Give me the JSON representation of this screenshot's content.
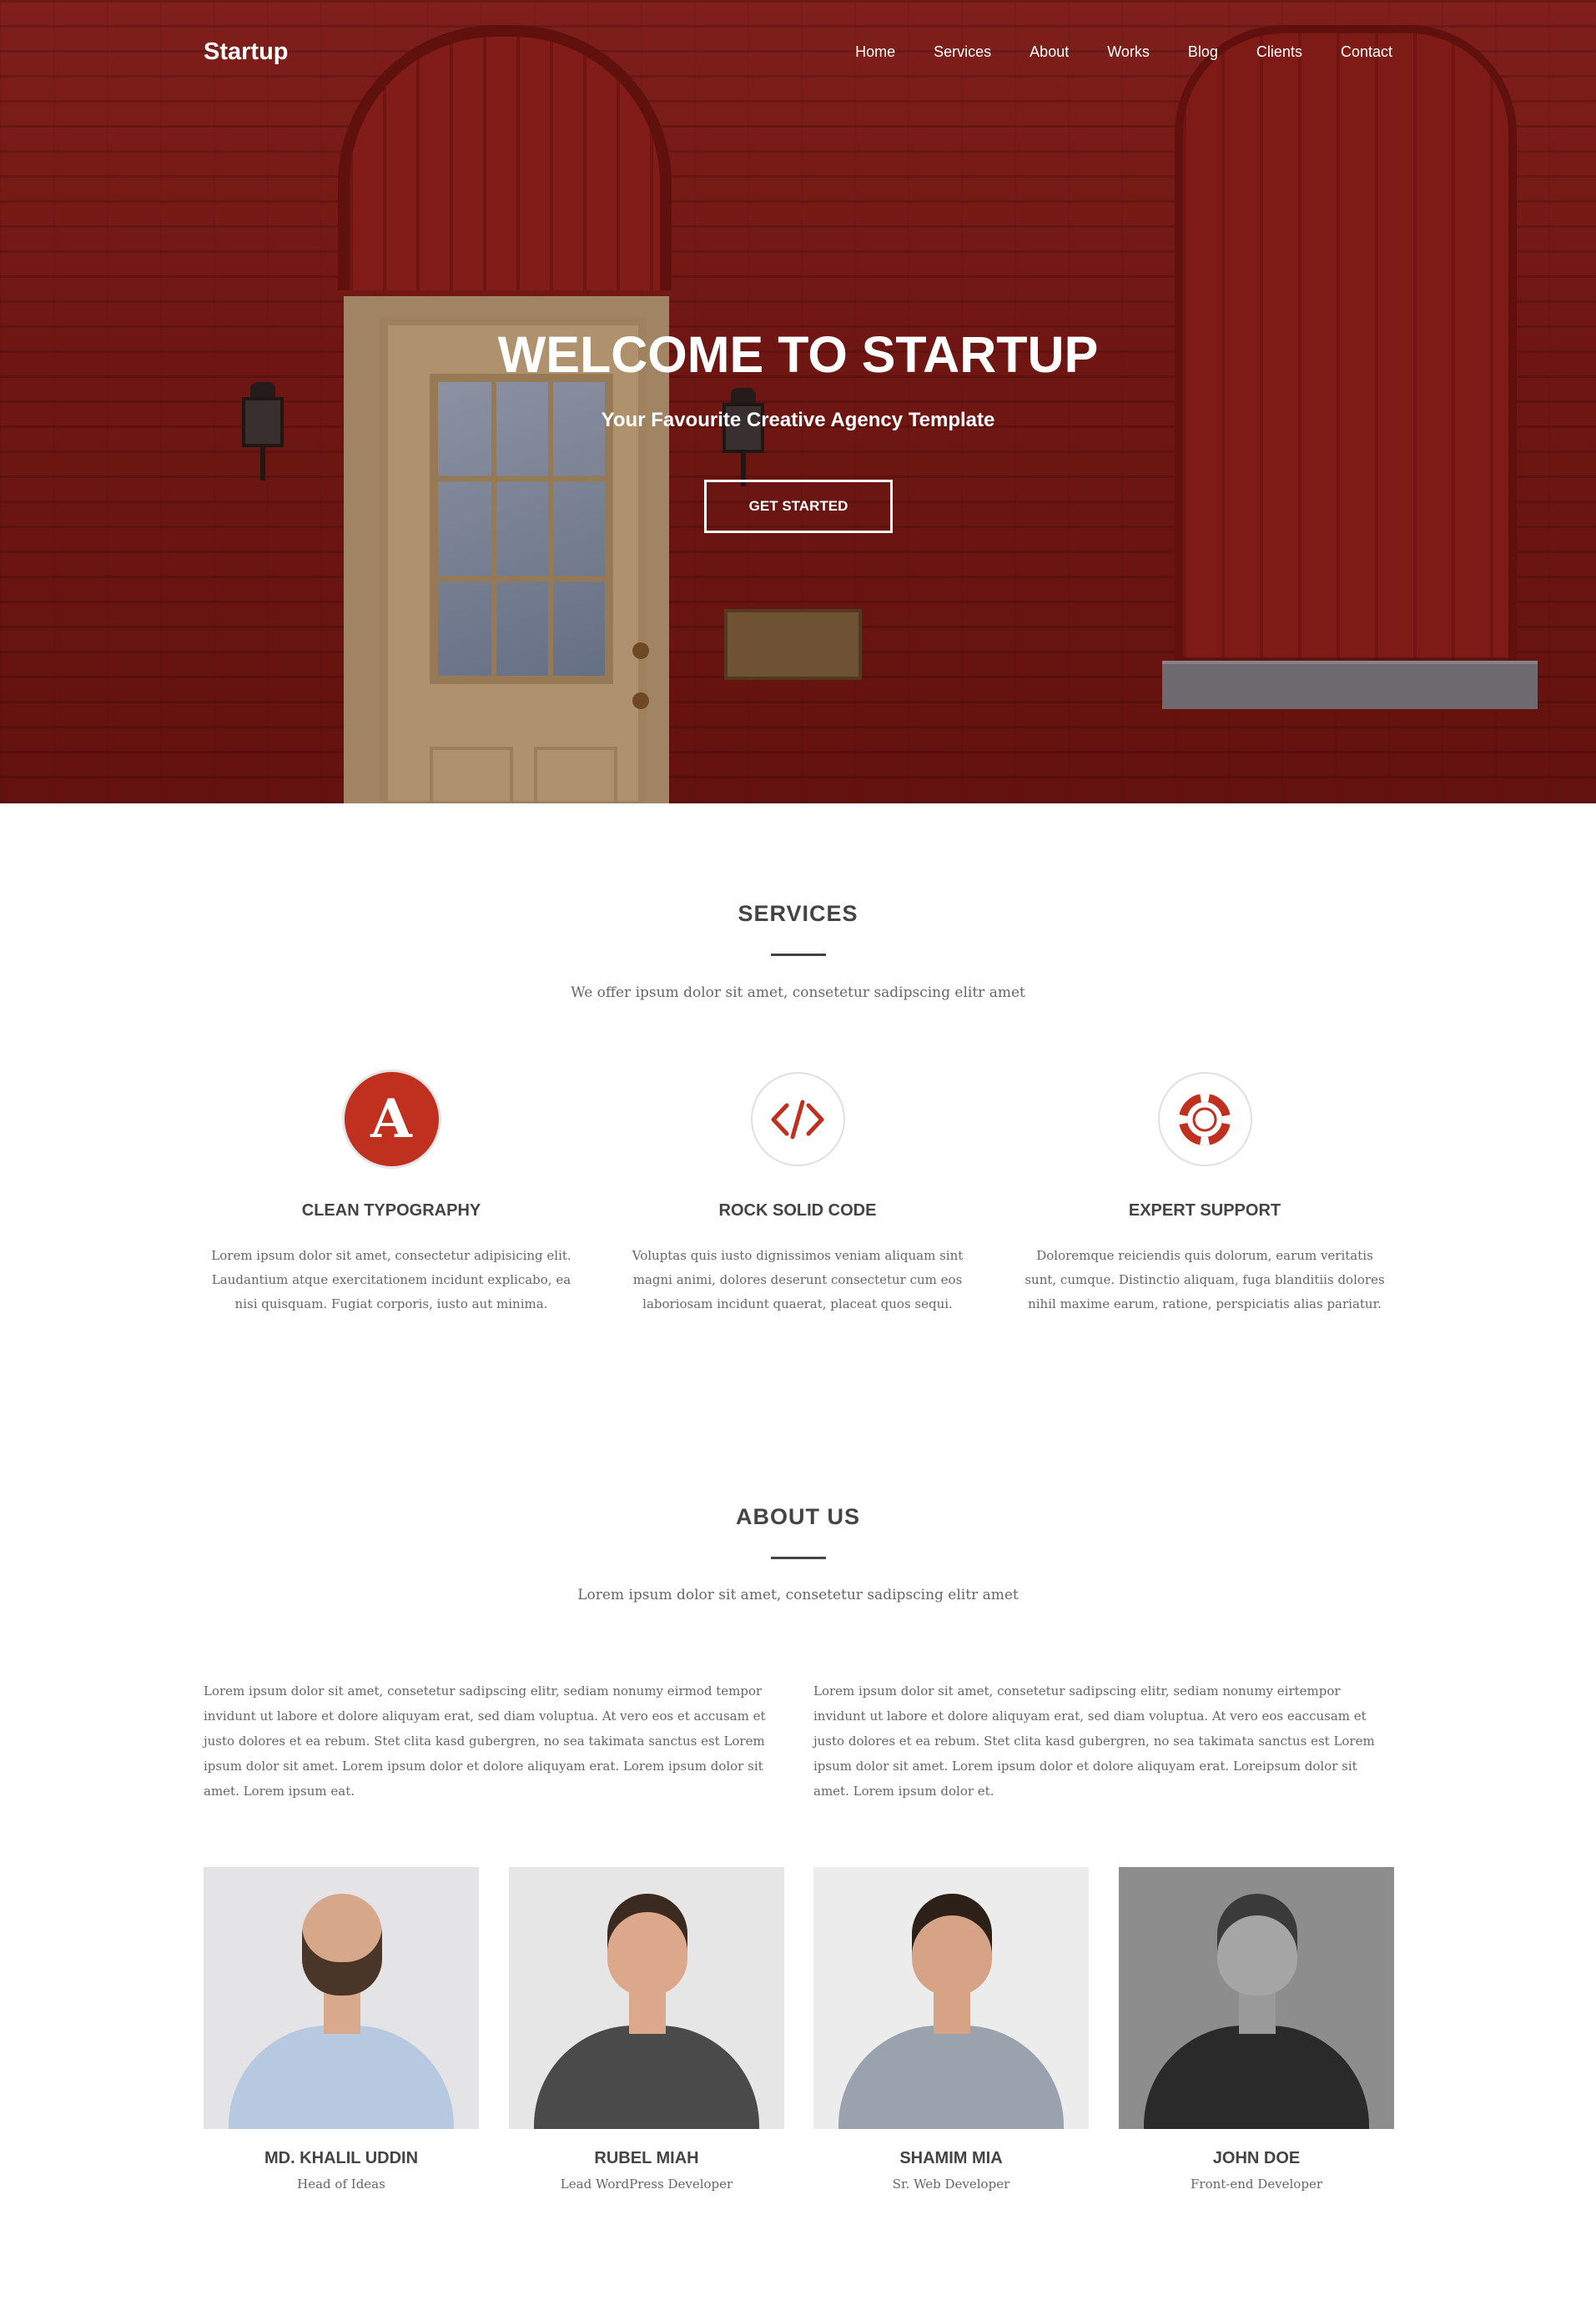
{
  "nav": {
    "brand": "Startup",
    "items": [
      "Home",
      "Services",
      "About",
      "Works",
      "Blog",
      "Clients",
      "Contact"
    ]
  },
  "hero": {
    "title": "WELCOME TO STARTUP",
    "subtitle": "Your Favourite Creative Agency Template",
    "button": "GET STARTED"
  },
  "services": {
    "title": "SERVICES",
    "subtitle": "We offer ipsum dolor sit amet, consetetur sadipscing elitr amet",
    "items": [
      {
        "name": "CLEAN TYPOGRAPHY",
        "icon": "typography-icon",
        "text": "Lorem ipsum dolor sit amet, consectetur adipisicing elit. Laudantium atque exercitationem incidunt explicabo, ea nisi quisquam. Fugiat corporis, iusto aut minima."
      },
      {
        "name": "ROCK SOLID CODE",
        "icon": "code-icon",
        "text": "Voluptas quis iusto dignissimos veniam aliquam sint magni animi, dolores deserunt consectetur cum eos laboriosam incidunt quaerat, placeat quos sequi."
      },
      {
        "name": "EXPERT SUPPORT",
        "icon": "lifebuoy-icon",
        "text": "Doloremque reiciendis quis dolorum, earum veritatis sunt, cumque. Distinctio aliquam, fuga blanditiis dolores nihil maxime earum, ratione, perspiciatis alias pariatur."
      }
    ]
  },
  "about": {
    "title": "ABOUT US",
    "subtitle": "Lorem ipsum dolor sit amet, consetetur sadipscing elitr amet",
    "col1": "Lorem ipsum dolor sit amet, consetetur sadipscing elitr, sediam nonumy eirmod tempor invidunt ut labore et dolore aliquyam erat, sed diam voluptua. At vero eos et accusam et justo dolores et ea rebum. Stet clita kasd gubergren, no sea takimata sanctus est Lorem ipsum dolor sit amet. Lorem ipsum dolor et dolore aliquyam erat. Lorem ipsum dolor sit amet. Lorem ipsum eat.",
    "col2": "Lorem ipsum dolor sit amet, consetetur sadipscing elitr, sediam nonumy eirtempor invidunt ut labore et dolore aliquyam erat, sed diam voluptua. At vero eos eaccusam et justo dolores et ea rebum. Stet clita kasd gubergren, no sea takimata sanctus est Lorem ipsum dolor sit amet. Lorem ipsum dolor et dolore aliquyam erat. Loreipsum dolor sit amet. Lorem ipsum dolor et."
  },
  "team": [
    {
      "name": "MD. KHALIL UDDIN",
      "role": "Head of Ideas"
    },
    {
      "name": "RUBEL MIAH",
      "role": "Lead WordPress Developer"
    },
    {
      "name": "SHAMIM MIA",
      "role": "Sr. Web Developer"
    },
    {
      "name": "JOHN DOE",
      "role": "Front-end Developer"
    }
  ],
  "colors": {
    "accent": "#c0301f",
    "text": "#444444",
    "muted": "#666666"
  }
}
